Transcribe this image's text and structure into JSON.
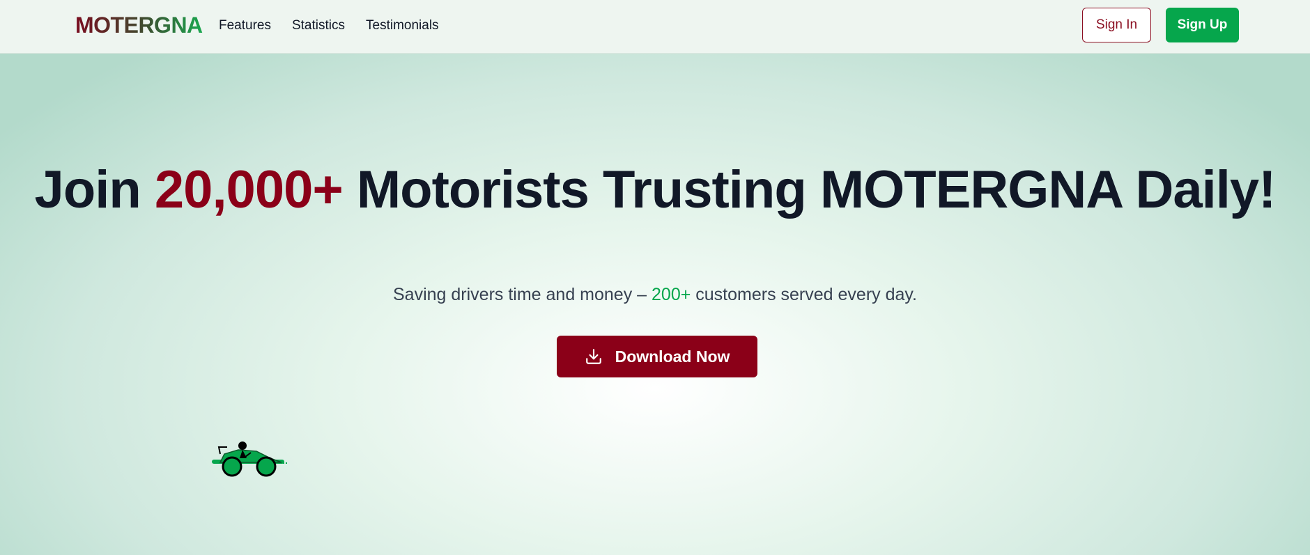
{
  "header": {
    "logo": "MOTERGNA",
    "nav": [
      {
        "label": "Features"
      },
      {
        "label": "Statistics"
      },
      {
        "label": "Testimonials"
      }
    ],
    "sign_in": "Sign In",
    "sign_up": "Sign Up"
  },
  "hero": {
    "title_pre": "Join ",
    "title_accent": "20,000+",
    "title_post": " Motorists Trusting MOTERGNA Daily!",
    "subtitle_pre": "Saving drivers time and money – ",
    "subtitle_accent": "200+",
    "subtitle_post": " customers served every day.",
    "cta_label": "Download Now",
    "cta_icon": "download-icon",
    "illustration": "car-icon"
  },
  "colors": {
    "brand_red": "#8b0018",
    "brand_green": "#06a64c",
    "text_dark": "#111827"
  }
}
